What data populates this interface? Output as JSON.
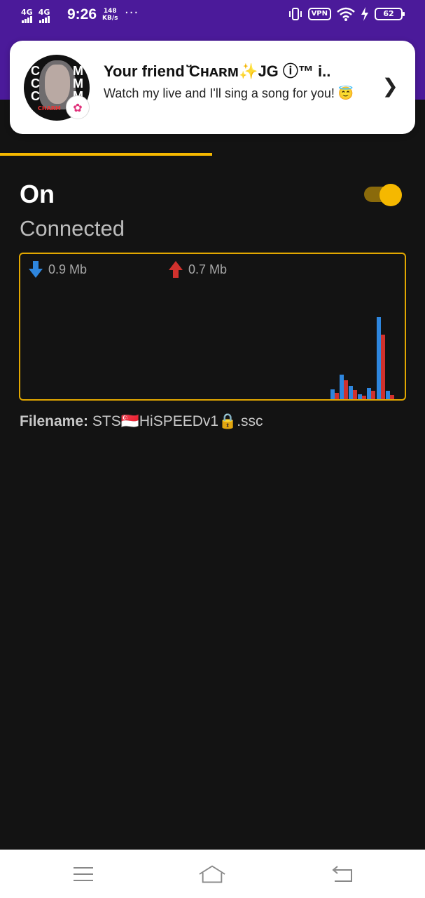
{
  "status_bar": {
    "network1": "4G",
    "network2": "4G",
    "time": "9:26",
    "speed_value": "148",
    "speed_unit": "KB/s",
    "more": "···",
    "vpn": "VPN",
    "battery": "62"
  },
  "notification": {
    "title": "Your friend ̈̆Cʜᴀʀᴍ✨JG ⓘ™ i..",
    "body": "Watch my live and I'll sing a song for you! 😇",
    "avatar_letters_left": "C\nC\nC",
    "avatar_letters_right": "M\nM\nM",
    "avatar_tag": "CHARM"
  },
  "main": {
    "state_label": "On",
    "toggle_on": true,
    "status_text": "Connected",
    "download_label": "0.9 Mb",
    "upload_label": "0.7 Mb",
    "filename_label": "Filename:",
    "filename_value": "STS🇸🇬HiSPEEDv1🔒.ssc"
  },
  "colors": {
    "accent": "#f5b800",
    "purple": "#4b1a9a",
    "download": "#2e86de",
    "upload": "#d0312d",
    "background": "#131313"
  },
  "icons": {
    "download": "arrow-down-icon",
    "upload": "arrow-up-icon",
    "nav_menu": "menu-icon",
    "nav_home": "home-icon",
    "nav_back": "back-icon"
  }
}
